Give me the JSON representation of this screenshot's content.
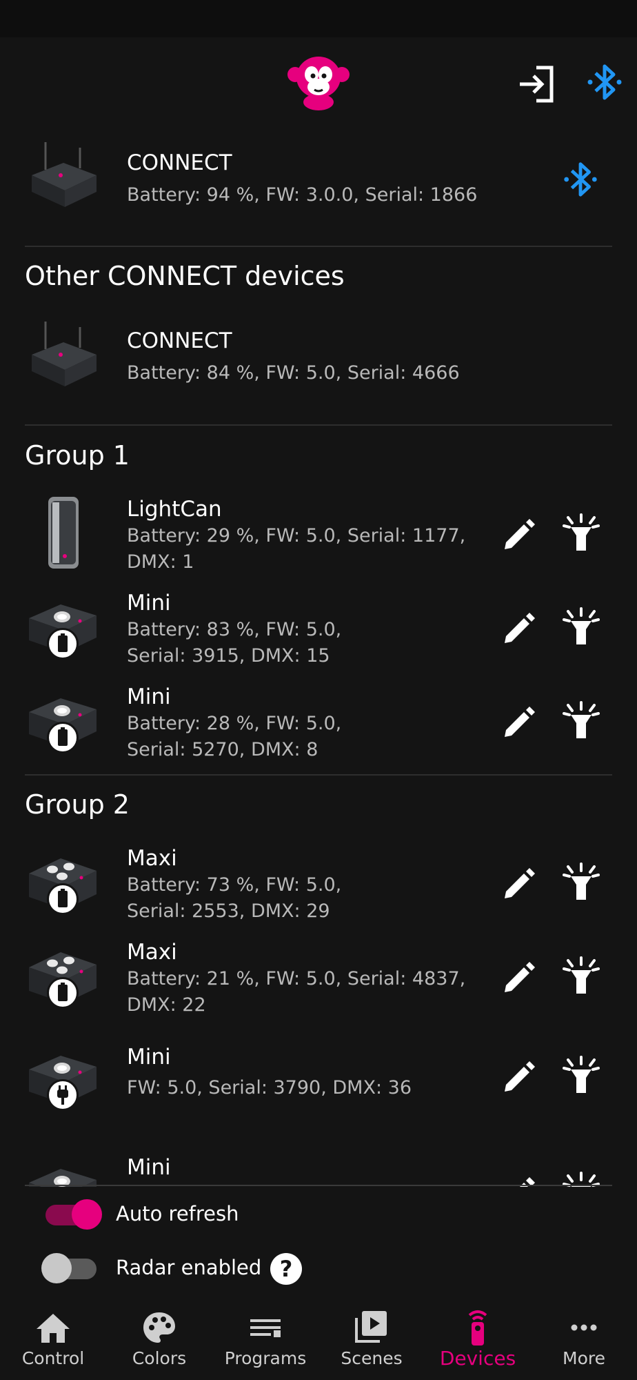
{
  "colors": {
    "accent": "#e6007e",
    "bluetooth": "#2196f3",
    "text_secondary": "#b9b9b9",
    "background": "#141414"
  },
  "header": {
    "logo_icon": "monkey-logo-icon",
    "login_icon": "login-icon",
    "bluetooth_icon": "bluetooth-icon"
  },
  "connected_device": {
    "name": "CONNECT",
    "info": "Battery: 94 %, FW: 3.0.0, Serial: 1866"
  },
  "other_section": {
    "title": "Other CONNECT devices",
    "devices": [
      {
        "name": "CONNECT",
        "info": "Battery: 84 %, FW: 5.0, Serial: 4666"
      }
    ]
  },
  "groups": [
    {
      "title": "Group 1",
      "devices": [
        {
          "name": "LightCan",
          "info": "Battery: 29 %, FW: 5.0, Serial: 1177, DMX: 1",
          "type": "can",
          "badge": "none"
        },
        {
          "name": "Mini",
          "info": "Battery: 83 %, FW: 5.0, Serial: 3915, DMX: 15",
          "type": "mini",
          "badge": "battery-icon"
        },
        {
          "name": "Mini",
          "info": "Battery: 28 %, FW: 5.0, Serial: 5270, DMX: 8",
          "type": "mini",
          "badge": "battery-icon"
        }
      ]
    },
    {
      "title": "Group 2",
      "devices": [
        {
          "name": "Maxi",
          "info": "Battery: 73 %, FW: 5.0, Serial: 2553, DMX: 29",
          "type": "maxi",
          "badge": "battery-icon"
        },
        {
          "name": "Maxi",
          "info": "Battery: 21 %, FW: 5.0, Serial: 4837, DMX: 22",
          "type": "maxi",
          "badge": "battery-icon"
        },
        {
          "name": "Mini",
          "info": "FW: 5.0, Serial: 3790, DMX: 36",
          "type": "mini",
          "badge": "plug-icon"
        },
        {
          "name": "Mini",
          "info": "",
          "type": "mini",
          "badge": "none"
        }
      ]
    }
  ],
  "toggles": {
    "auto_refresh": {
      "label": "Auto refresh",
      "on": true
    },
    "radar": {
      "label": "Radar enabled",
      "on": false,
      "help": "?"
    }
  },
  "nav": [
    {
      "label": "Control",
      "icon": "home-icon",
      "active": false
    },
    {
      "label": "Colors",
      "icon": "palette-icon",
      "active": false
    },
    {
      "label": "Programs",
      "icon": "list-icon",
      "active": false
    },
    {
      "label": "Scenes",
      "icon": "play-library-icon",
      "active": false
    },
    {
      "label": "Devices",
      "icon": "remote-icon",
      "active": true
    },
    {
      "label": "More",
      "icon": "more-dots-icon",
      "active": false
    }
  ]
}
